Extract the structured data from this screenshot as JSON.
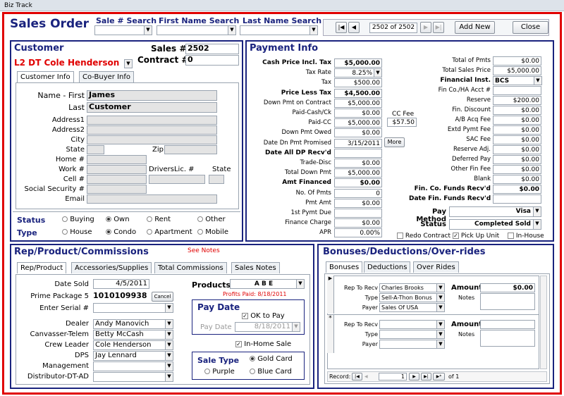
{
  "app": {
    "title": "Biz Track"
  },
  "header": {
    "title": "Sales Order",
    "sale_search_label": "Sale # Search",
    "first_search_label": "First Name Search",
    "last_search_label": "Last Name Search",
    "record_indicator": "2502 of 2502",
    "add_new": "Add New",
    "close": "Close"
  },
  "customer": {
    "heading": "Customer",
    "sales_label": "Sales #",
    "sales_value": "2502",
    "contract_label": "Contract #",
    "contract_value": "0",
    "dealer_line": "L2  DT Cole Henderson",
    "tabs": [
      "Customer Info",
      "Co-Buyer Info"
    ],
    "name_first_label": "Name - First",
    "first_name": "James",
    "last_label": "Last",
    "last_name": "Customer",
    "address1_label": "Address1",
    "address2_label": "Address2",
    "city_label": "City",
    "state_label": "State",
    "zip_label": "Zip",
    "home_label": "Home #",
    "work_label": "Work #",
    "drivers_label": "DriversLic. #",
    "dl_state_label": "State",
    "cell_label": "Cell #",
    "ssn_label": "Social Security #",
    "email_label": "Email",
    "status_label": "Status",
    "status_options": [
      "Buying",
      "Own",
      "Rent",
      "Other"
    ],
    "type_label": "Type",
    "type_options": [
      "House",
      "Condo",
      "Apartment",
      "Mobile"
    ]
  },
  "payment": {
    "heading": "Payment Info",
    "left": [
      {
        "label": "Cash Price Incl. Tax",
        "value": "$5,000.00",
        "bold": true
      },
      {
        "label": "Tax Rate",
        "value": "8.25%",
        "dd": true
      },
      {
        "label": "Tax",
        "value": "$500.00"
      },
      {
        "label": "Price Less Tax",
        "value": "$4,500.00",
        "bold": true
      },
      {
        "label": "Down Pmt on Contract",
        "value": "$5,000.00"
      },
      {
        "label": "Paid-Cash/Ck",
        "value": "$0.00"
      },
      {
        "label": "Paid-CC",
        "value": "$5,000.00"
      },
      {
        "label": "Down Pmt Owed",
        "value": "$0.00"
      },
      {
        "label": "Date Dn Pmt Promised",
        "value": "3/15/2011"
      },
      {
        "label": "Date All DP Recv'd",
        "value": "",
        "bold": true
      },
      {
        "label": "Trade-Disc",
        "value": "$0.00"
      },
      {
        "label": "Total Down Pmt",
        "value": "$5,000.00"
      },
      {
        "label": "Amt Financed",
        "value": "$0.00",
        "bold": true
      },
      {
        "label": "No. Of Pmts",
        "value": "0"
      },
      {
        "label": "Pmt Amt",
        "value": "$0.00"
      },
      {
        "label": "1st Pymt Due",
        "value": ""
      },
      {
        "label": "Finance Charge",
        "value": "$0.00"
      },
      {
        "label": "APR",
        "value": "0.00%"
      }
    ],
    "cc_fee_label": "CC Fee",
    "cc_fee_value": "$57.50",
    "more_button": "More",
    "right": [
      {
        "label": "Total of Pmts",
        "value": "$0.00"
      },
      {
        "label": "Total Sales Price",
        "value": "$5,000.00"
      },
      {
        "label": "Financial Inst.",
        "value": "BCS",
        "bold": true,
        "dd": true
      },
      {
        "label": "Fin Co./HA Acct #",
        "value": ""
      },
      {
        "label": "Reserve",
        "value": "$200.00"
      },
      {
        "label": "Fin. Discount",
        "value": "$0.00"
      },
      {
        "label": "A/B Acq Fee",
        "value": "$0.00"
      },
      {
        "label": "Extd Pymt Fee",
        "value": "$0.00"
      },
      {
        "label": "SAC Fee",
        "value": "$0.00"
      },
      {
        "label": "Reserve Adj.",
        "value": "$0.00"
      },
      {
        "label": "Deferred Pay",
        "value": "$0.00"
      },
      {
        "label": "Other Fin Fee",
        "value": "$0.00"
      },
      {
        "label": "Blank",
        "value": "$0.00"
      },
      {
        "label": "Fin. Co. Funds Recv'd",
        "value": "$0.00",
        "bold": true
      },
      {
        "label": "Date Fin. Funds Recv'd",
        "value": "",
        "bold": true
      }
    ],
    "pay_method_label": "Pay Method",
    "pay_method_value": "Visa",
    "status_label": "Status",
    "status_value": "Completed Sold",
    "redo_contract": "Redo Contract",
    "pick_up_unit": "Pick Up Unit",
    "in_house": "In-House"
  },
  "rep": {
    "heading": "Rep/Product/Commissions",
    "see_notes": "See Notes",
    "tabs": [
      "Rep/Product",
      "Accessories/Supplies",
      "Total Commissions",
      "Sales Notes"
    ],
    "date_sold_label": "Date Sold",
    "date_sold": "4/5/2011",
    "prime_label": "Prime Package 5",
    "prime_value": "1010109938",
    "cancel": "Cancel",
    "serial_label": "Enter Serial #",
    "products_label": "Products",
    "products_value": "A B E",
    "profits_paid": "Profits Paid: 8/18/2011",
    "pay_date_heading": "Pay Date",
    "ok_to_pay": "OK to Pay",
    "pay_date_label": "Pay Date",
    "pay_date_value": "8/18/2011",
    "in_home_sale": "In-Home Sale",
    "sale_type_label": "Sale Type",
    "gold_card": "Gold Card",
    "purple": "Purple",
    "blue_card": "Blue Card",
    "people": [
      {
        "label": "Dealer",
        "value": "Andy Manovich"
      },
      {
        "label": "Canvasser-Telem",
        "value": "Betty McCash"
      },
      {
        "label": "Crew Leader",
        "value": "Cole Henderson"
      },
      {
        "label": "DPS",
        "value": "Jay Lennard"
      },
      {
        "label": "Management",
        "value": ""
      },
      {
        "label": "Distributor-DT-AD",
        "value": ""
      }
    ]
  },
  "bonuses": {
    "heading": "Bonuses/Deductions/Over-rides",
    "tabs": [
      "Bonuses",
      "Deductions",
      "Over Rides"
    ],
    "rep_to_recv_label": "Rep To Recv",
    "type_label": "Type",
    "payer_label": "Payer",
    "amount_label": "Amount",
    "notes_label": "Notes",
    "row1": {
      "rep": "Charles Brooks",
      "type": "Sell-A-Thon Bonus",
      "payer": "Sales Of USA",
      "amount": "$0.00"
    },
    "record_label": "Record:",
    "record_value": "1",
    "of_label": "of 1"
  },
  "colors": {
    "frame_red": "#e00000",
    "navy": "#1a237e"
  }
}
